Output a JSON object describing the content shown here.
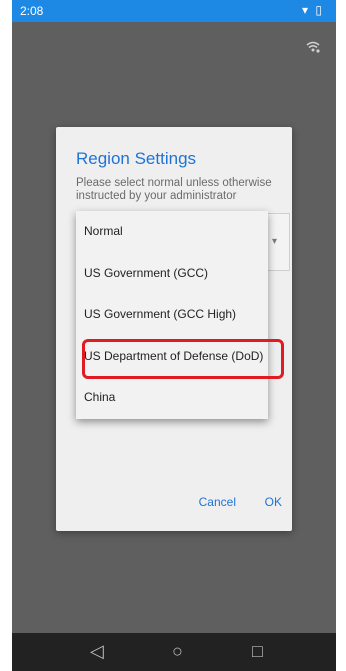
{
  "status_bar": {
    "time": "2:08",
    "icons": "▾ ▯"
  },
  "dialog": {
    "title": "Region Settings",
    "subtitle": "Please select normal unless otherwise instructed by your administrator",
    "cancel_label": "Cancel",
    "ok_label": "OK"
  },
  "dropdown": {
    "items": [
      "Normal",
      "US Government (GCC)",
      "US Government (GCC High)",
      "US Department of Defense (DoD)",
      "China"
    ],
    "highlighted_index": 3
  },
  "nav": {
    "back": "◁",
    "home": "○",
    "recents": "□"
  },
  "colors": {
    "accent": "#1e73d6",
    "status_bar": "#1e88e5",
    "highlight": "#e01b24"
  }
}
